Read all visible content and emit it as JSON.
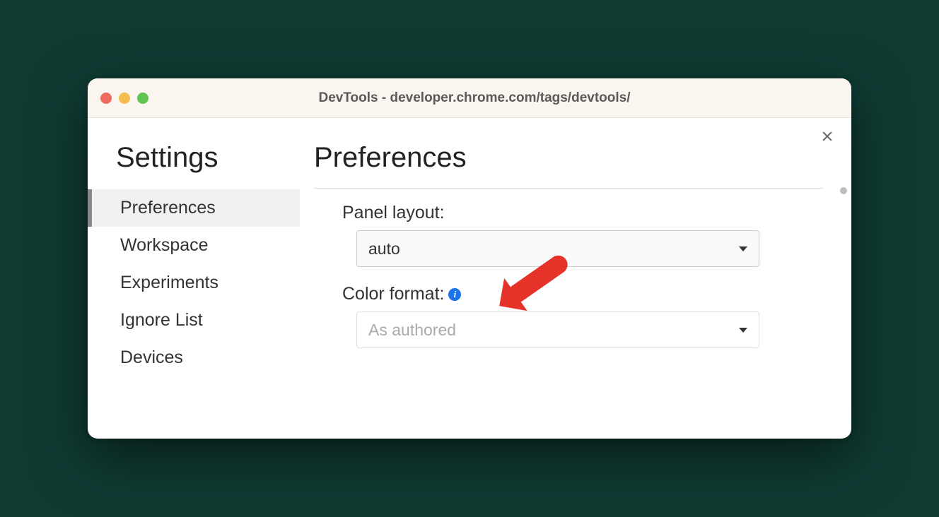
{
  "window": {
    "title": "DevTools - developer.chrome.com/tags/devtools/"
  },
  "sidebar": {
    "heading": "Settings",
    "items": [
      {
        "label": "Preferences",
        "active": true
      },
      {
        "label": "Workspace",
        "active": false
      },
      {
        "label": "Experiments",
        "active": false
      },
      {
        "label": "Ignore List",
        "active": false
      },
      {
        "label": "Devices",
        "active": false
      }
    ]
  },
  "main": {
    "heading": "Preferences",
    "panel_layout": {
      "label": "Panel layout:",
      "value": "auto"
    },
    "color_format": {
      "label": "Color format:",
      "value": "As authored",
      "disabled": true,
      "info_icon": "i"
    }
  }
}
